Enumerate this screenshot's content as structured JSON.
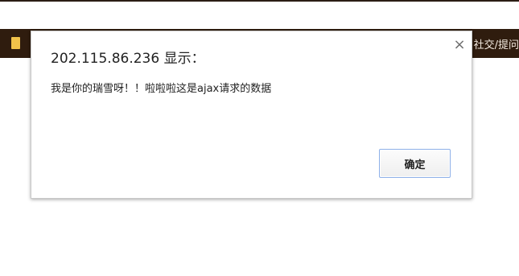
{
  "page": {
    "nav_text": "社交/提问"
  },
  "dialog": {
    "title": "202.115.86.236 显示：",
    "close_symbol": "×",
    "message": "我是你的瑞雪呀！！啦啦啦这是ajax请求的数据",
    "ok_label": "确定"
  },
  "icons": {
    "close": "close-icon",
    "nav": "bookmark-icon"
  },
  "colors": {
    "nav_background": "#2f1c0e",
    "nav_icon": "#f1c24a",
    "button_border": "#8db0e8"
  }
}
